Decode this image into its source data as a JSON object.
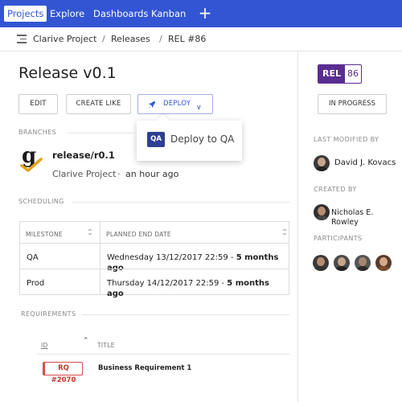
{
  "nav": {
    "tabs": [
      {
        "label": "Projects"
      },
      {
        "label": "Explore"
      },
      {
        "label": "Dashboards"
      },
      {
        "label": "Kanban"
      }
    ],
    "add": "+"
  },
  "breadcrumb": [
    "Clarive Project",
    "Releases",
    "REL #86"
  ],
  "breadcrumb_sep": "/",
  "release": {
    "title": "Release v0.1",
    "tag_type": "REL",
    "tag_number": "86",
    "status": "IN PROGRESS"
  },
  "actions": {
    "edit": "EDIT",
    "create_like": "CREATE LIKE",
    "deploy": "DEPLOY"
  },
  "deploy_menu": {
    "badge": "QA",
    "label": "Deploy to QA"
  },
  "branches": {
    "label": "BRANCHES",
    "name": "release/r0.1",
    "project": "Clarive Project",
    "dot": "·",
    "time": "an hour ago"
  },
  "scheduling": {
    "label": "SCHEDULING",
    "columns": [
      "MILESTONE",
      "PLANNED END DATE"
    ],
    "rows": [
      {
        "milestone": "QA",
        "date": "Wednesday 13/12/2017 22:59 - ",
        "relative": "5 months ago"
      },
      {
        "milestone": "Prod",
        "date": "Thursday 14/12/2017 22:59 - ",
        "relative": "5 months ago"
      }
    ]
  },
  "requirements": {
    "label": "REQUIREMENTS",
    "columns": [
      "ID",
      "TITLE"
    ],
    "rows": [
      {
        "id": "RQ #2070",
        "title": "Business Requirement 1"
      }
    ]
  },
  "sidebar": {
    "last_modified_label": "LAST MODIFIED BY",
    "last_modified_by": "David J. Kovacs",
    "created_label": "CREATED BY",
    "created_by": "Nicholas E. Rowley",
    "participants_label": "PARTICIPANTS"
  },
  "colors": {
    "primary": "#3355d4",
    "release_tag": "#5a2d91",
    "qa_badge": "#2f3f8f",
    "requirement": "#d94b4b"
  }
}
